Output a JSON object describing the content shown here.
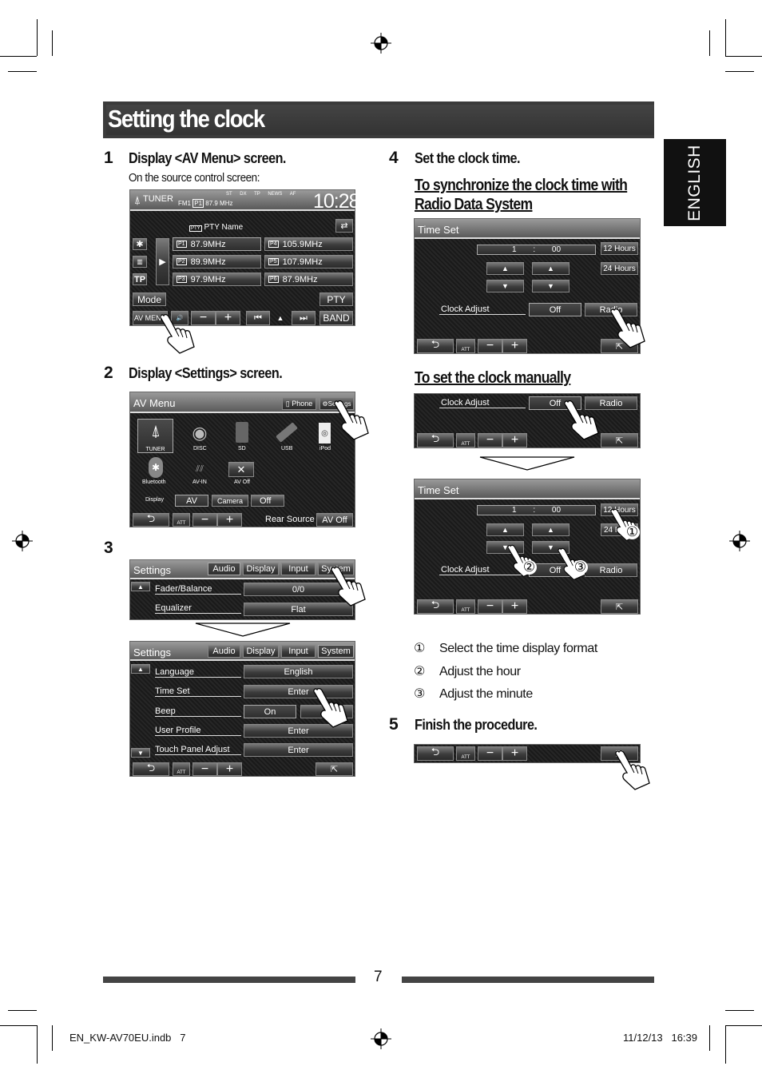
{
  "title": "Setting the clock",
  "language_tab": "ENGLISH",
  "steps": [
    {
      "num": "1",
      "heading": "Display <AV Menu> screen.",
      "note": "On the source control screen:"
    },
    {
      "num": "2",
      "heading": "Display <Settings> screen."
    },
    {
      "num": "3"
    },
    {
      "num": "4",
      "heading": "Set the clock time."
    },
    {
      "num": "5",
      "heading": "Finish the procedure."
    }
  ],
  "sections": {
    "sync_line1": "To synchronize the clock time with",
    "sync_line2": "Radio Data System",
    "manual": "To set the clock manually"
  },
  "tuner_screen": {
    "source": "TUNER",
    "band_info": "FM1",
    "preset_badge": "P1",
    "frequency": "87.9 MHz",
    "indicators": [
      "ST",
      "DX",
      "TP",
      "NEWS",
      "AF"
    ],
    "clock": "10:28",
    "pty_name": "PTY Name",
    "tp": "TP",
    "presets": [
      {
        "id": "P1",
        "freq": "87.9MHz"
      },
      {
        "id": "P2",
        "freq": "89.9MHz"
      },
      {
        "id": "P3",
        "freq": "97.9MHz"
      },
      {
        "id": "P4",
        "freq": "105.9MHz"
      },
      {
        "id": "P5",
        "freq": "107.9MHz"
      },
      {
        "id": "P6",
        "freq": "87.9MHz"
      }
    ],
    "mode": "Mode",
    "pty": "PTY",
    "av_menu": "AV MENU",
    "band": "BAND"
  },
  "common": {
    "att": "ATT",
    "minus": "−",
    "plus": "+"
  },
  "av_menu_screen": {
    "title": "AV Menu",
    "phone": "Phone",
    "settings": "Settings",
    "sources": [
      "TUNER",
      "DISC",
      "SD",
      "USB",
      "iPod",
      "Bluetooth",
      "AV-IN",
      "AV Off"
    ],
    "display_label": "Display",
    "display_options": [
      "AV",
      "Camera",
      "Off"
    ],
    "rear_source": "Rear Source",
    "rear_value": "AV Off"
  },
  "settings_screen": {
    "title": "Settings",
    "tabs": [
      "Audio",
      "Display",
      "Input",
      "System"
    ],
    "audio_rows": [
      {
        "label": "Fader/Balance",
        "value": "0/0"
      },
      {
        "label": "Equalizer",
        "value": "Flat"
      }
    ],
    "system_rows": [
      {
        "label": "Language",
        "value": "English"
      },
      {
        "label": "Time Set",
        "value": "Enter"
      },
      {
        "label": "Beep",
        "value": "On"
      },
      {
        "label": "User Profile",
        "value": "Enter"
      },
      {
        "label": "Touch Panel Adjust",
        "value": "Enter"
      }
    ]
  },
  "time_set_screen": {
    "title": "Time Set",
    "hour": "1",
    "sep": ":",
    "minute": "00",
    "format_12": "12 Hours",
    "format_24": "24 Hours",
    "clock_adjust": "Clock Adjust",
    "off": "Off",
    "radio": "Radio"
  },
  "legend": [
    {
      "n": "①",
      "text": "Select the time display format"
    },
    {
      "n": "②",
      "text": "Adjust the hour"
    },
    {
      "n": "③",
      "text": "Adjust the minute"
    }
  ],
  "page_number": "7",
  "footer": {
    "file": "EN_KW-AV70EU.indb   7",
    "date": "11/12/13   16:39"
  }
}
